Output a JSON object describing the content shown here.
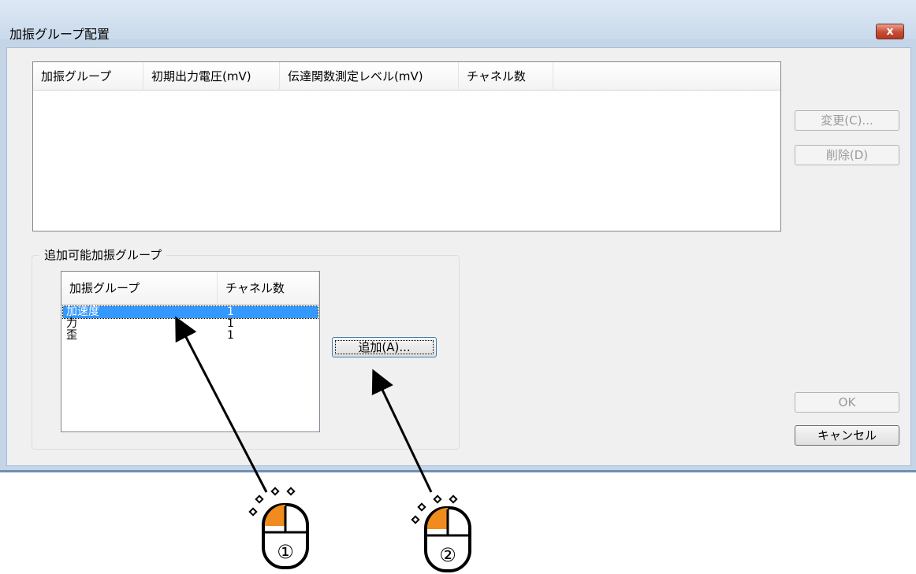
{
  "window": {
    "title": "加振グループ配置",
    "close_label": "x"
  },
  "assigned_list": {
    "columns": [
      "加振グループ",
      "初期出力電圧(mV)",
      "伝達関数測定レベル(mV)",
      "チャネル数"
    ],
    "rows": []
  },
  "side_buttons": {
    "change": "変更(C)...",
    "delete": "削除(D)",
    "ok": "OK",
    "cancel": "キャンセル"
  },
  "available_group": {
    "legend": "追加可能加振グループ",
    "columns": [
      "加振グループ",
      "チャネル数"
    ],
    "rows": [
      {
        "name": "加速度",
        "channels": "1",
        "selected": true
      },
      {
        "name": "力",
        "channels": "1",
        "selected": false
      },
      {
        "name": "歪",
        "channels": "1",
        "selected": false
      }
    ],
    "add_button": "追加(A)..."
  },
  "annotations": {
    "step1": "①",
    "step2": "②"
  },
  "colors": {
    "selection": "#3399ff",
    "mouse_button": "#f08c1e",
    "title_bar": "#c9daec"
  }
}
